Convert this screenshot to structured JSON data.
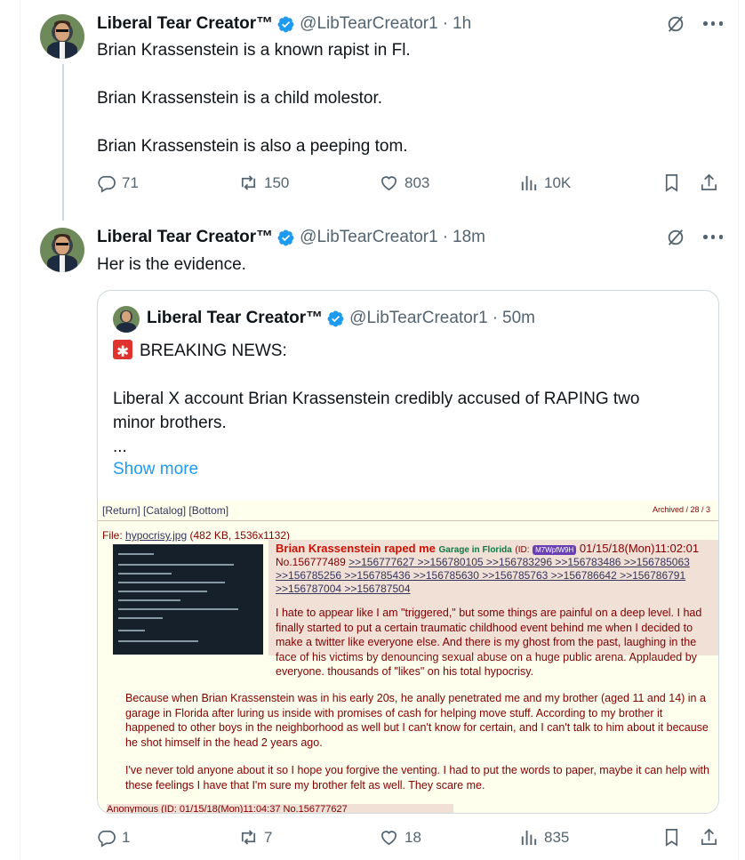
{
  "tweet1": {
    "display_name": "Liberal Tear Creator™",
    "handle": "@LibTearCreator1",
    "separator": "·",
    "time": "1h",
    "lines": [
      "Brian Krassenstein is a known rapist in Fl.",
      "Brian Krassenstein is a child molestor.",
      "Brian Krassenstein is also a peeping tom."
    ],
    "replies": "71",
    "reposts": "150",
    "likes": "803",
    "views": "10K"
  },
  "tweet2": {
    "display_name": "Liberal Tear Creator™",
    "handle": "@LibTearCreator1",
    "separator": "·",
    "time": "18m",
    "text": "Her is the evidence.",
    "replies": "1",
    "reposts": "7",
    "likes": "18",
    "views": "835"
  },
  "quoted": {
    "display_name": "Liberal Tear Creator™",
    "handle": "@LibTearCreator1",
    "separator": "·",
    "time": "50m",
    "line1": "BREAKING NEWS:",
    "line2": "Liberal X account Brian Krassenstein credibly accused of RAPING two",
    "line3": "minor brothers.",
    "ellipsis": "...",
    "show_more": "Show more"
  },
  "chan": {
    "nav": "[Return] [Catalog] [Bottom]",
    "archived": "Archived / 28 / 3",
    "file_prefix": "File:",
    "file_name": "hypocrisy.jpg",
    "file_meta": "(482 KB, 1536x1132)",
    "subject": "Brian Krassenstein raped me",
    "poster": "Garage in Florida",
    "id_label": "(ID:",
    "id_value": "M7WpfW9H",
    "datetime": "01/15/18(Mon)11:02:01",
    "post_no": "No.156777489",
    "reply_links": ">>156777627 >>156780105 >>156783296 >>156783486 >>156785063 >>156785256 >>156785436 >>156785630 >>156785763 >>156786642 >>156786791 >>156787004 >>156787504",
    "p1": "I hate to appear like I am \"triggered,\" but some things are painful on a deep level. I had finally started to put a certain traumatic childhood event behind me when I decided to make a twitter like everyone else. And there is my ghost from the past, laughing in the face of his victims by denouncing sexual abuse on a huge public arena. Applauded by everyone. thousands of \"likes\" on his total hypocrisy.",
    "p2": "Because when Brian Krassenstein was in his early 20s, he anally penetrated me and my brother (aged 11 and 14) in a garage in Florida after luring us inside with promises of cash for helping move stuff. According to my brother it happened to other boys in the neighborhood as well but I can't know for certain, and I can't talk to him about it because he shot himself in the head 2 years ago.",
    "p3": "I've never told anyone about it so I hope you forgive the venting. I had to put the words to paper, maybe it can help with these feelings I have that I'm sure my brother felt as well. They scare me.",
    "next_post": "Anonymous (ID:  01/15/18(Mon)11:04:37 No.156777627"
  },
  "colors": {
    "accent": "#1d9bf0",
    "muted": "#536471",
    "chan_bg": "#ffffee",
    "chan_text": "#800000"
  }
}
